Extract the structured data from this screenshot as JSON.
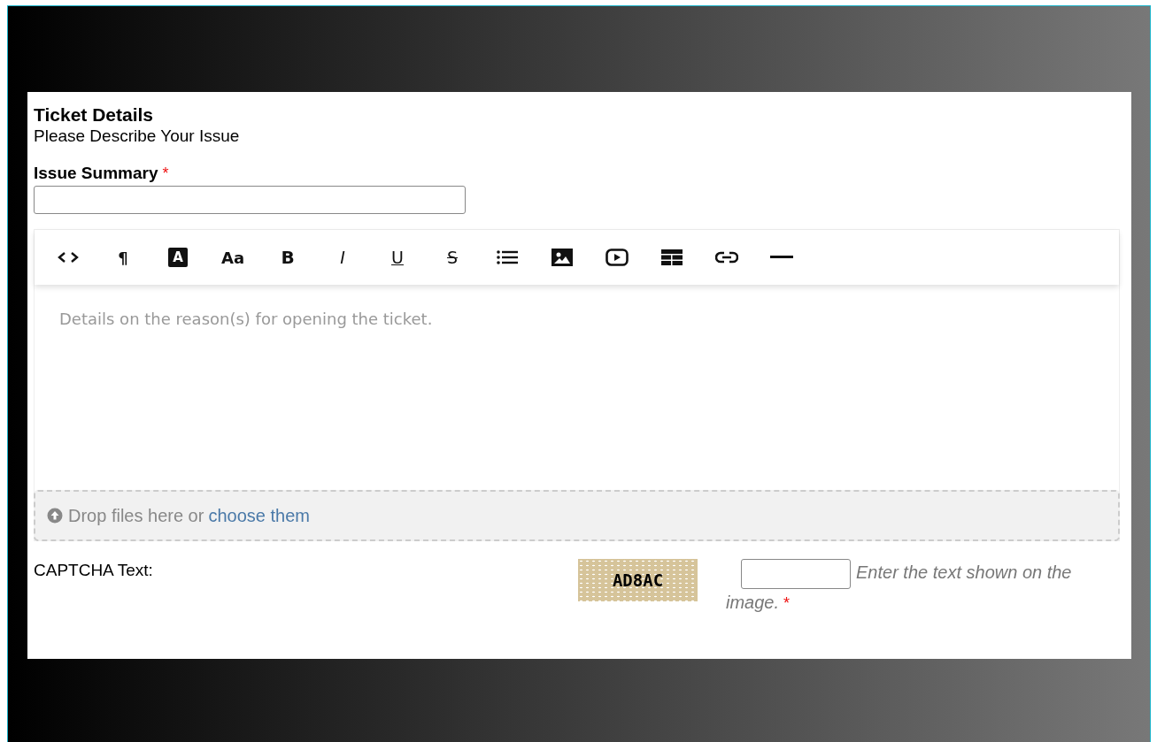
{
  "form": {
    "title": "Ticket Details",
    "subtitle": "Please Describe Your Issue"
  },
  "issue_summary": {
    "label": "Issue Summary",
    "required_mark": "*"
  },
  "toolbar": [
    {
      "kind": "code"
    },
    {
      "kind": "glyph",
      "label": "¶"
    },
    {
      "kind": "badge",
      "label": "A"
    },
    {
      "kind": "glyph",
      "label": "Aa"
    },
    {
      "kind": "bold",
      "label": "B"
    },
    {
      "kind": "italic",
      "label": "I"
    },
    {
      "kind": "underline",
      "label": "U"
    },
    {
      "kind": "strike",
      "label": "S"
    },
    {
      "kind": "list"
    },
    {
      "kind": "image"
    },
    {
      "kind": "video"
    },
    {
      "kind": "table"
    },
    {
      "kind": "link"
    },
    {
      "kind": "rule"
    }
  ],
  "editor": {
    "placeholder": "Details on the reason(s) for opening the ticket."
  },
  "dropzone": {
    "text": "Drop files here or",
    "link": "choose them"
  },
  "captcha": {
    "label": "CAPTCHA Text:",
    "image_text": "AD8AC",
    "hint_lines": [
      "Enter the text shown on the",
      "image."
    ],
    "required_mark": "*"
  }
}
